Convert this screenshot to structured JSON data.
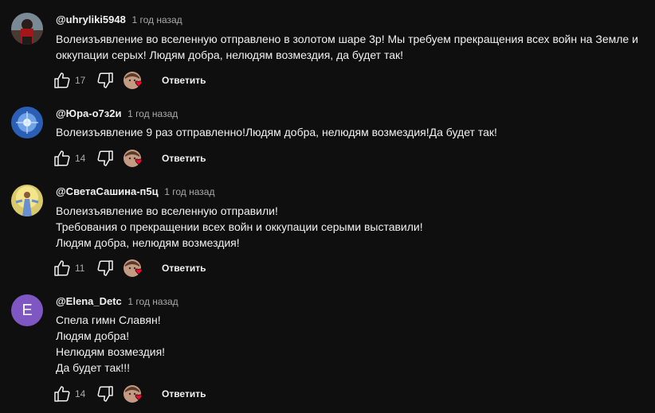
{
  "comments": [
    {
      "author": "@uhryliki5948",
      "time": "1 год назад",
      "lines": [
        "Волеизъявление во вселенную отправлено в золотом шаре 3р! Мы требуем прекращения всех войн на Земле и",
        "оккупации серых! Людям добра, нелюдям возмездия, да будет так!"
      ],
      "likes": "17",
      "reply_label": "Ответить",
      "avatar_icon": "user-photo-icon"
    },
    {
      "author": "@Юра-о7з2и",
      "time": "1 год назад",
      "lines": [
        "Волеизъявление 9 раз отправленно!Людям добра, нелюдям возмездия!Да будет так!"
      ],
      "likes": "14",
      "reply_label": "Ответить",
      "avatar_icon": "user-photo-icon"
    },
    {
      "author": "@СветаСашина-п5ц",
      "time": "1 год назад",
      "lines": [
        "Волеизъявление во вселенную отправили!",
        "Требования о прекращении всех войн и оккупации серыми выставили!",
        "Людям добра, нелюдям возмездия!"
      ],
      "likes": "11",
      "reply_label": "Ответить",
      "avatar_icon": "user-photo-icon"
    },
    {
      "author": "@Elena_Detc",
      "time": "1 год назад",
      "lines": [
        "Спела гимн Славян!",
        "Людям добра!",
        "Нелюдям возмездия!",
        "Да будет так!!!"
      ],
      "likes": "14",
      "reply_label": "Ответить",
      "avatar_letter": "E",
      "avatar_color": "#7e57c2"
    }
  ],
  "colors": {
    "background": "#0f0f0f",
    "text": "#f1f1f1",
    "muted": "#aaaaaa",
    "heart": "#ff0033"
  }
}
